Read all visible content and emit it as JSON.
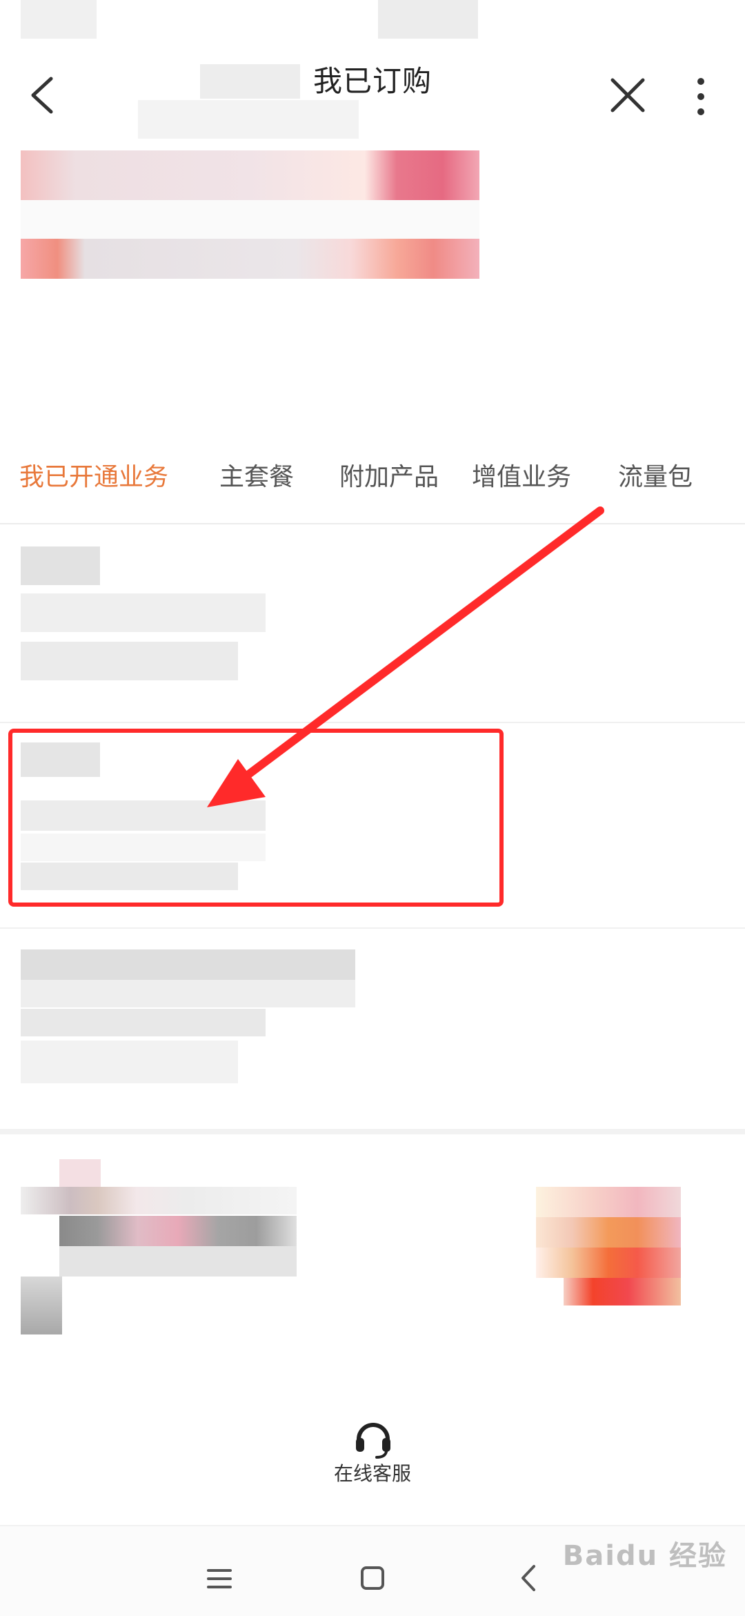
{
  "header": {
    "title": "我已订购",
    "icons": [
      "back-icon",
      "close-icon",
      "more-icon"
    ]
  },
  "tabs": [
    {
      "label": "我已开通业务",
      "active": true
    },
    {
      "label": "主套餐",
      "active": false
    },
    {
      "label": "附加产品",
      "active": false
    },
    {
      "label": "增值业务",
      "active": false
    },
    {
      "label": "流量包",
      "active": false
    }
  ],
  "service": {
    "label": "在线客服",
    "icon": "headset-icon"
  },
  "navigation": {
    "icons": [
      "menu-icon",
      "home-square-icon",
      "back-chevron-icon"
    ]
  },
  "watermark": {
    "text": "Baidu 经验"
  },
  "colors": {
    "active_tab": "#e8783a",
    "highlight": "#ff2a2a"
  }
}
